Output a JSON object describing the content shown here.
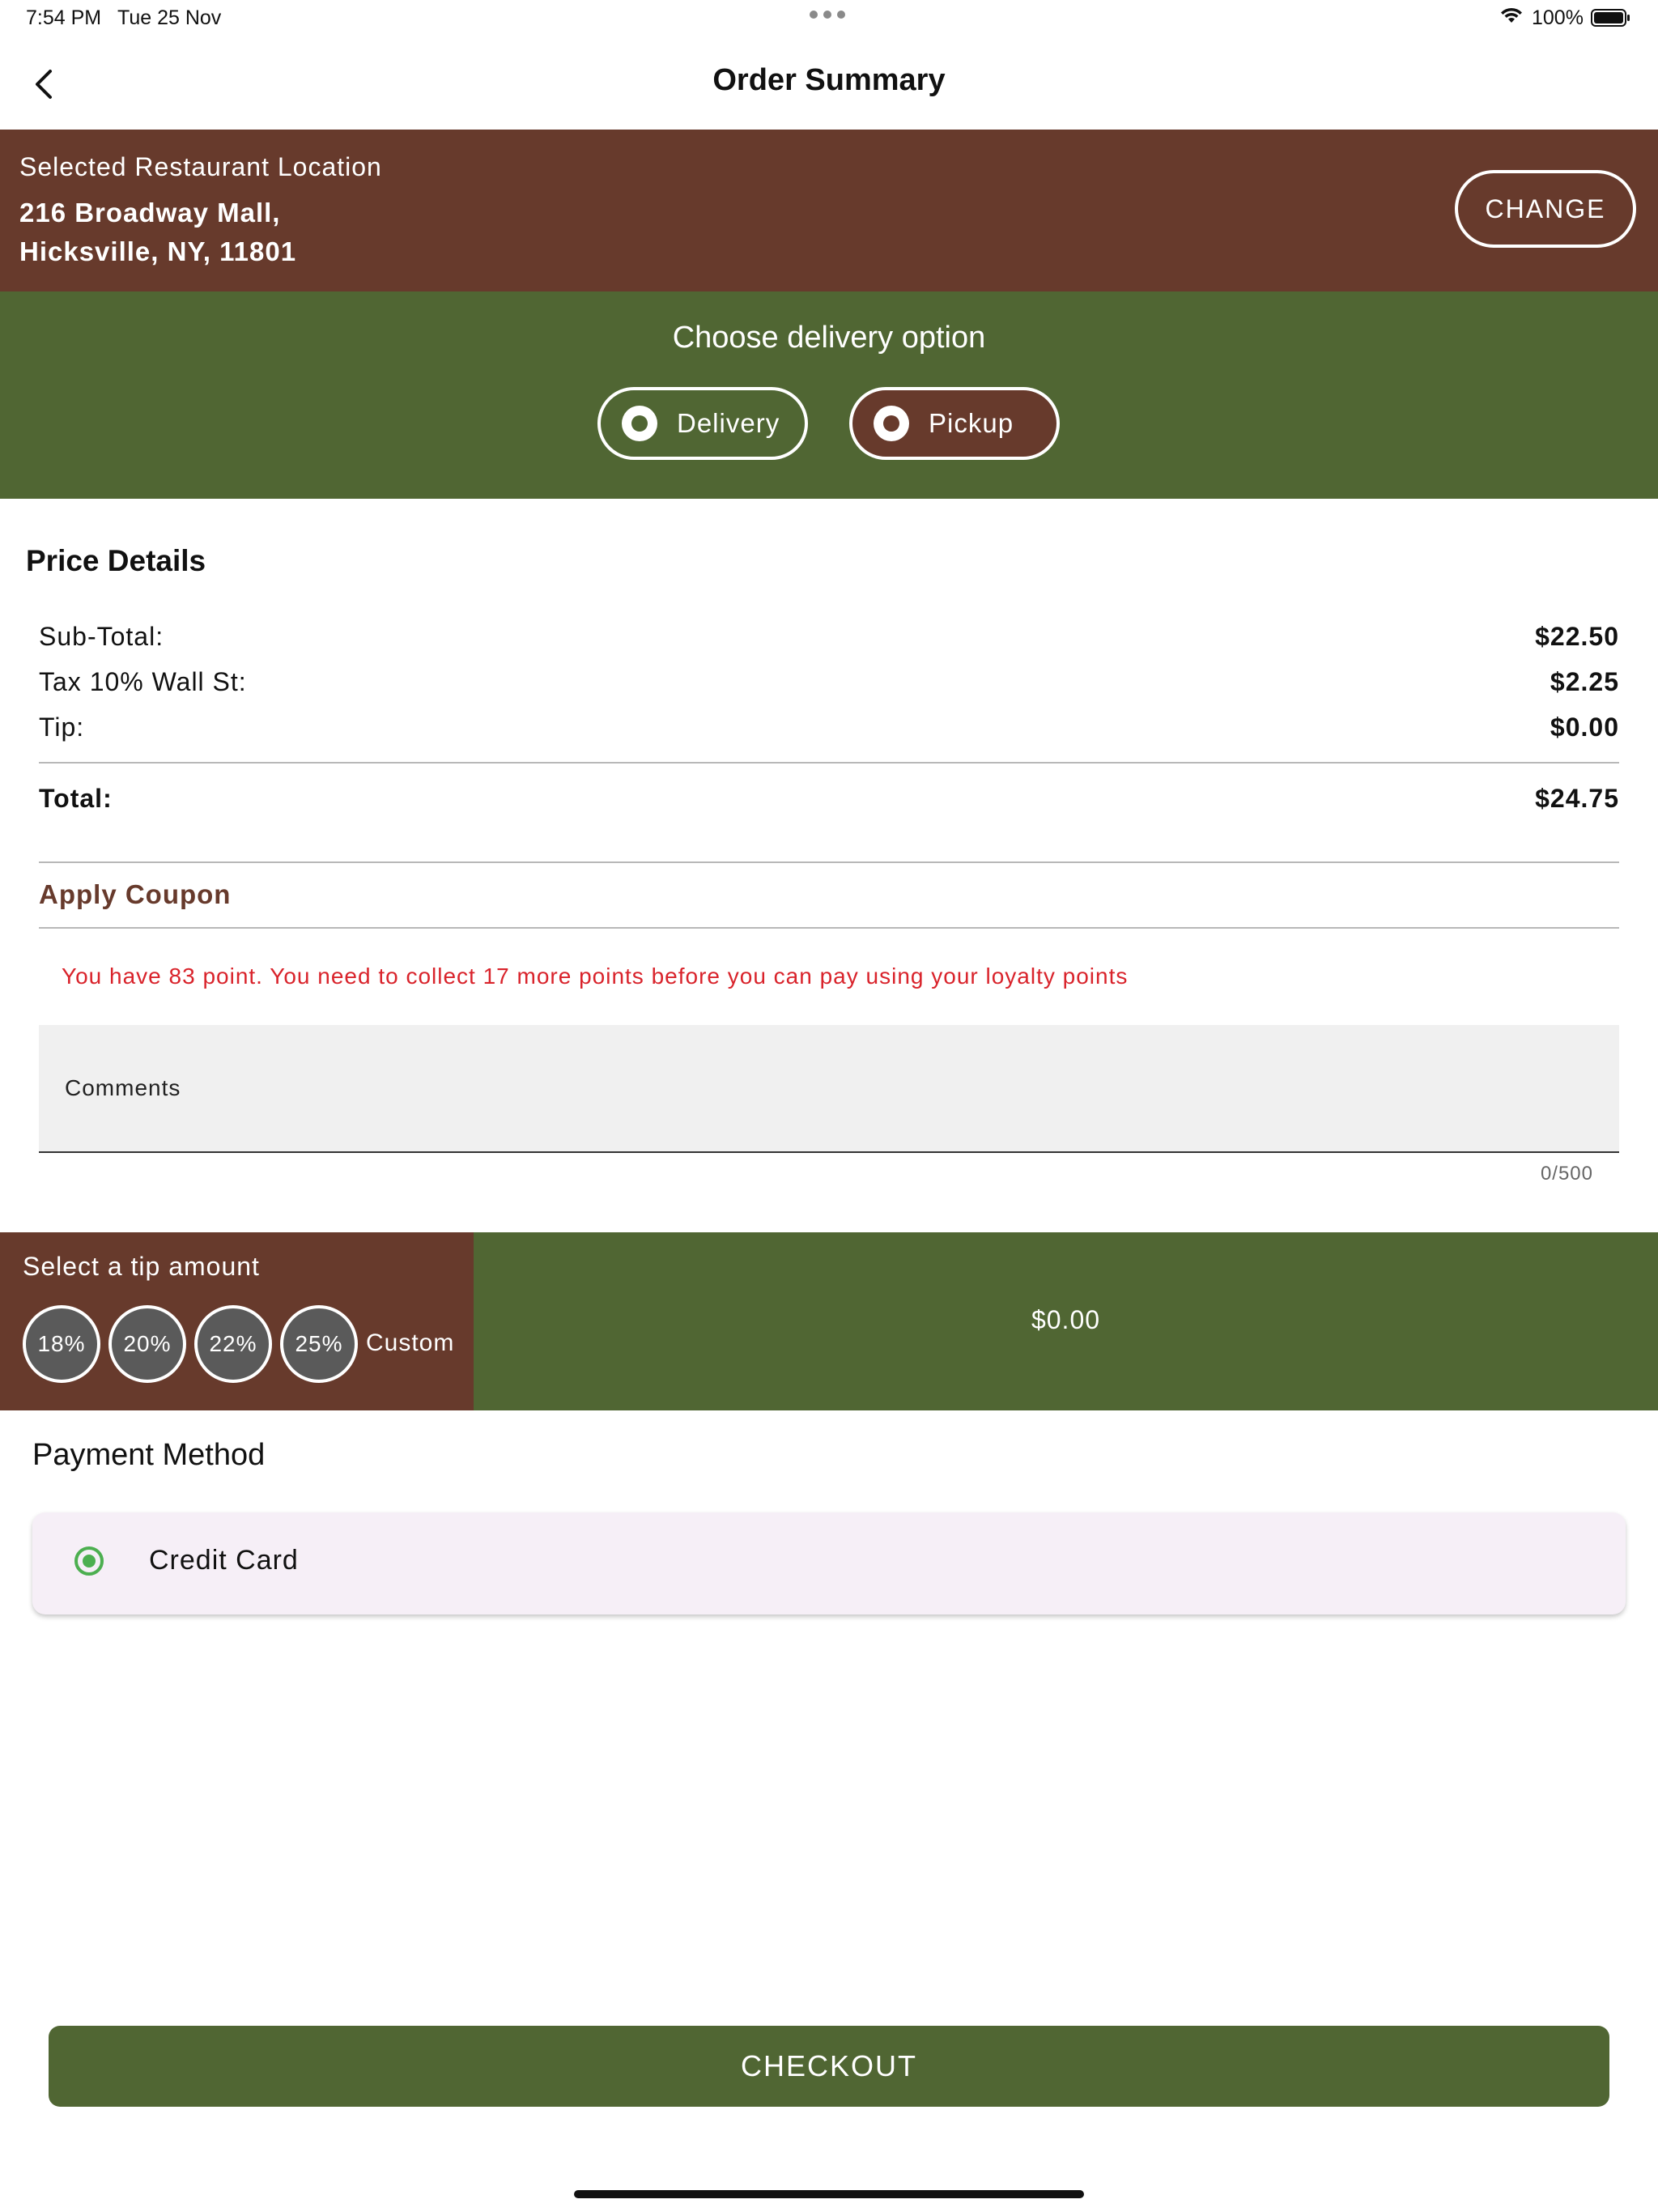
{
  "status_bar": {
    "time": "7:54 PM",
    "date": "Tue 25 Nov",
    "battery_percent": "100%",
    "battery_level": 1.0
  },
  "nav": {
    "title": "Order Summary",
    "back_icon": "chevron-left-icon"
  },
  "location": {
    "heading": "Selected Restaurant Location",
    "address_line1": "216 Broadway Mall,",
    "address_line2": "Hicksville, NY, 11801",
    "change_label": "CHANGE"
  },
  "delivery": {
    "heading": "Choose delivery option",
    "options": [
      {
        "label": "Delivery",
        "selected": false
      },
      {
        "label": "Pickup",
        "selected": true
      }
    ]
  },
  "price_details": {
    "heading": "Price Details",
    "rows": [
      {
        "label": "Sub-Total:",
        "value": "$22.50"
      },
      {
        "label": "Tax 10% Wall St:",
        "value": "$2.25"
      },
      {
        "label": "Tip:",
        "value": "$0.00"
      }
    ],
    "total_label": "Total:",
    "total_value": "$24.75"
  },
  "coupon": {
    "label": "Apply Coupon"
  },
  "loyalty": {
    "message": "You have 83 point. You need to collect 17 more points before you can pay using your loyalty points"
  },
  "comments": {
    "placeholder": "Comments",
    "counter": "0/500"
  },
  "tip": {
    "heading": "Select a tip amount",
    "options": [
      "18%",
      "20%",
      "22%",
      "25%"
    ],
    "custom_label": "Custom",
    "amount": "$0.00"
  },
  "payment": {
    "heading": "Payment Method",
    "method_label": "Credit Card",
    "selected": true
  },
  "checkout": {
    "label": "CHECKOUT"
  },
  "colors": {
    "brown": "#673a2c",
    "green": "#506633",
    "error_red": "#d9232b",
    "radio_green": "#4caf50"
  }
}
